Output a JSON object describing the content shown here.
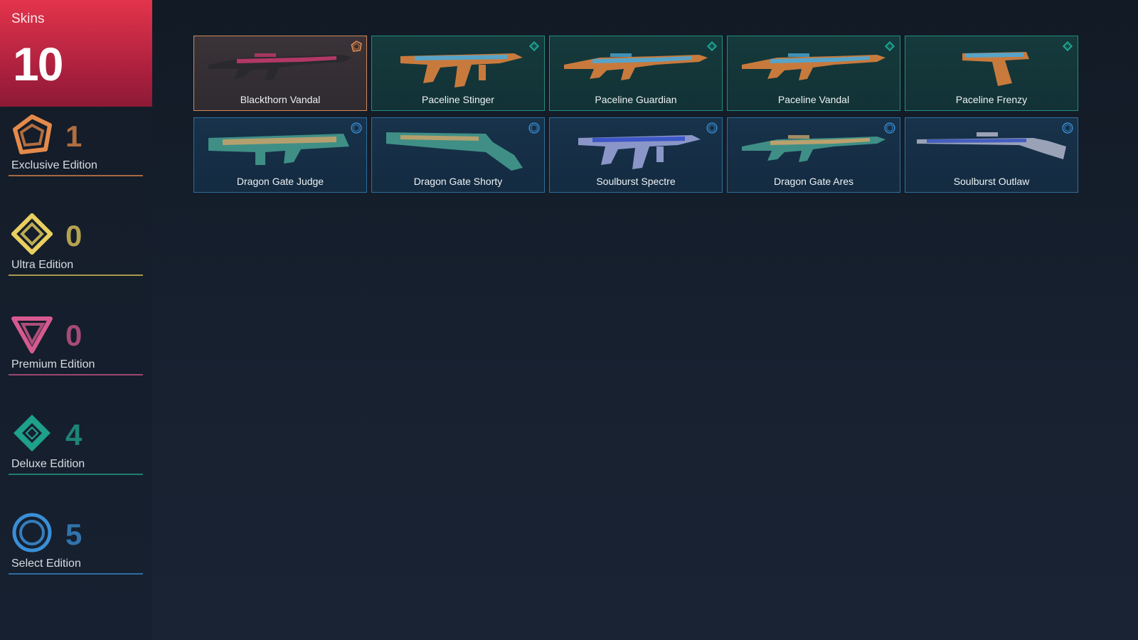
{
  "summary": {
    "label": "Skins",
    "count": "10"
  },
  "tiers": [
    {
      "key": "exclusive",
      "name": "Exclusive Edition",
      "count": "1",
      "color": "#e58a4a",
      "icon": "exclusive-edition-icon"
    },
    {
      "key": "ultra",
      "name": "Ultra Edition",
      "count": "0",
      "color": "#e9cf5f",
      "icon": "ultra-edition-icon"
    },
    {
      "key": "premium",
      "name": "Premium Edition",
      "count": "0",
      "color": "#d55a8f",
      "icon": "premium-edition-icon"
    },
    {
      "key": "deluxe",
      "name": "Deluxe Edition",
      "count": "4",
      "color": "#1fa88f",
      "icon": "deluxe-edition-icon"
    },
    {
      "key": "select",
      "name": "Select Edition",
      "count": "5",
      "color": "#3a8fd6",
      "icon": "select-edition-icon"
    }
  ],
  "skins": [
    {
      "name": "Blackthorn Vandal",
      "tier": "exclusive",
      "weapon": "rifle"
    },
    {
      "name": "Paceline Stinger",
      "tier": "deluxe",
      "weapon": "smg"
    },
    {
      "name": "Paceline Guardian",
      "tier": "deluxe",
      "weapon": "rifle"
    },
    {
      "name": "Paceline Vandal",
      "tier": "deluxe",
      "weapon": "rifle"
    },
    {
      "name": "Paceline Frenzy",
      "tier": "deluxe",
      "weapon": "pistol"
    },
    {
      "name": "Dragon Gate Judge",
      "tier": "select",
      "weapon": "shotgun"
    },
    {
      "name": "Dragon Gate Shorty",
      "tier": "select",
      "weapon": "shorty"
    },
    {
      "name": "Soulburst Spectre",
      "tier": "select",
      "weapon": "smg"
    },
    {
      "name": "Dragon Gate Ares",
      "tier": "select",
      "weapon": "lmg"
    },
    {
      "name": "Soulburst Outlaw",
      "tier": "select",
      "weapon": "sniper"
    }
  ]
}
